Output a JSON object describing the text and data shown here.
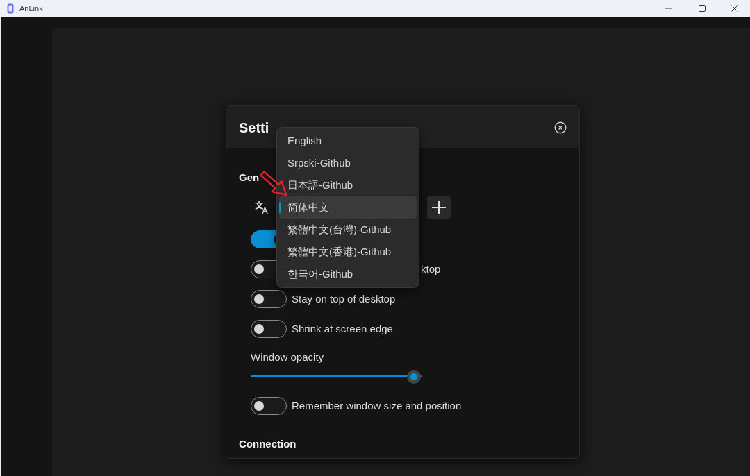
{
  "window": {
    "title": "AnLink"
  },
  "settings_dialog": {
    "title": "Setti",
    "general": {
      "heading": "Gen",
      "language_menu": [
        {
          "label": "English",
          "selected": false
        },
        {
          "label": "Srpski-Github",
          "selected": false
        },
        {
          "label": "日本語-Github",
          "selected": false
        },
        {
          "label": "简体中文",
          "selected": true
        },
        {
          "label": "繁體中文(台灣)-Github",
          "selected": false
        },
        {
          "label": "繁體中文(香港)-Github",
          "selected": false
        },
        {
          "label": "한국어-Github",
          "selected": false
        }
      ],
      "options": [
        {
          "kind": "toggle",
          "on": true
        },
        {
          "kind": "toggle",
          "on": false,
          "label": "ktop"
        },
        {
          "kind": "toggle",
          "on": false,
          "label": "Stay on top of desktop"
        },
        {
          "kind": "toggle",
          "on": false,
          "label": "Shrink at screen edge"
        },
        {
          "kind": "slider",
          "label": "Window opacity",
          "level": 0.95
        },
        {
          "kind": "toggle",
          "on": false,
          "label": "Remember window size and position"
        }
      ]
    },
    "connection": {
      "heading": "Connection"
    }
  }
}
